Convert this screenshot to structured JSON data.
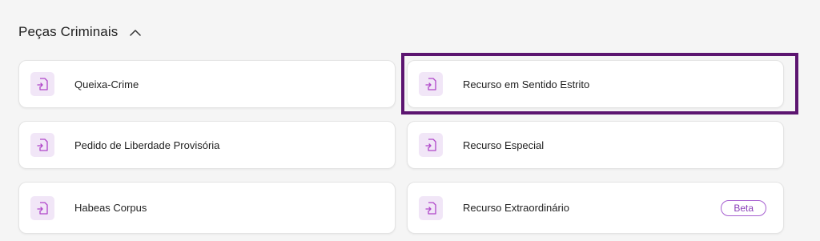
{
  "section": {
    "title": "Peças Criminais"
  },
  "cards": {
    "left": [
      {
        "label": "Queixa-Crime"
      },
      {
        "label": "Pedido de Liberdade Provisória"
      },
      {
        "label": "Habeas Corpus"
      }
    ],
    "right": [
      {
        "label": "Recurso em Sentido Estrito"
      },
      {
        "label": "Recurso Especial"
      },
      {
        "label": "Recurso Extraordinário",
        "badge": "Beta"
      }
    ]
  },
  "colors": {
    "accent": "#a65fd0",
    "icon_background": "#f1e6f7",
    "highlight_outline": "#5c1570"
  },
  "icons": {
    "card_icon": "document-import-icon",
    "collapse_icon": "chevron-up-icon"
  }
}
